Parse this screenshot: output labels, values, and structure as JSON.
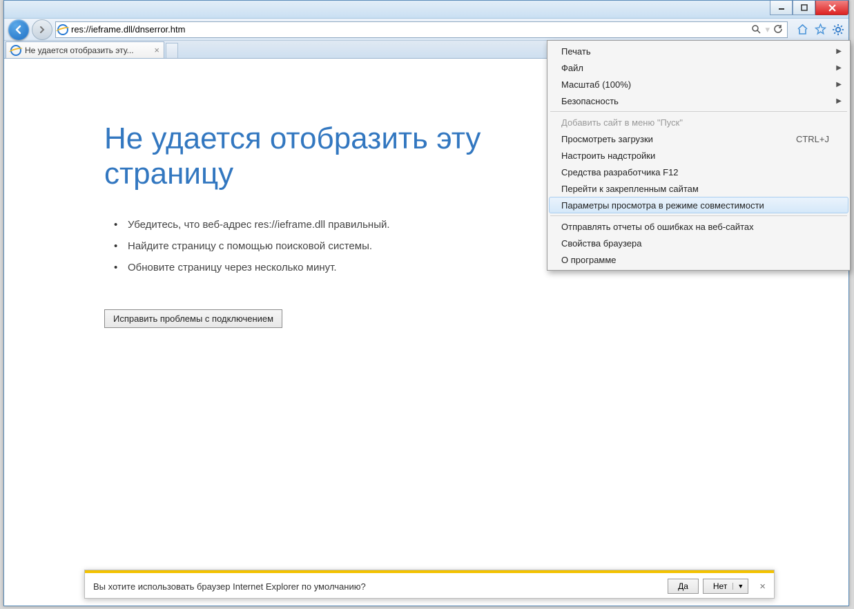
{
  "address": {
    "url": "res://ieframe.dll/dnserror.htm"
  },
  "tab": {
    "title": "Не удается отобразить эту..."
  },
  "error": {
    "title": "Не удается отобразить эту страницу",
    "bullets": [
      "Убедитесь, что веб-адрес res://ieframe.dll правильный.",
      "Найдите страницу с помощью поисковой системы.",
      "Обновите страницу через несколько минут."
    ],
    "fix_button": "Исправить проблемы с подключением"
  },
  "menu": {
    "groups": [
      [
        {
          "label": "Печать",
          "sub": true
        },
        {
          "label": "Файл",
          "sub": true
        },
        {
          "label": "Масштаб (100%)",
          "sub": true
        },
        {
          "label": "Безопасность",
          "sub": true
        }
      ],
      [
        {
          "label": "Добавить сайт в меню \"Пуск\"",
          "disabled": true
        },
        {
          "label": "Просмотреть загрузки",
          "shortcut": "CTRL+J"
        },
        {
          "label": "Настроить надстройки"
        },
        {
          "label": "Средства разработчика F12"
        },
        {
          "label": "Перейти к закрепленным сайтам"
        },
        {
          "label": "Параметры просмотра в режиме совместимости",
          "highlight": true
        }
      ],
      [
        {
          "label": "Отправлять отчеты об ошибках на веб-сайтах"
        },
        {
          "label": "Свойства браузера"
        },
        {
          "label": "О программе"
        }
      ]
    ]
  },
  "infobar": {
    "text": "Вы хотите использовать браузер Internet Explorer по умолчанию?",
    "yes": "Да",
    "no": "Нет"
  }
}
